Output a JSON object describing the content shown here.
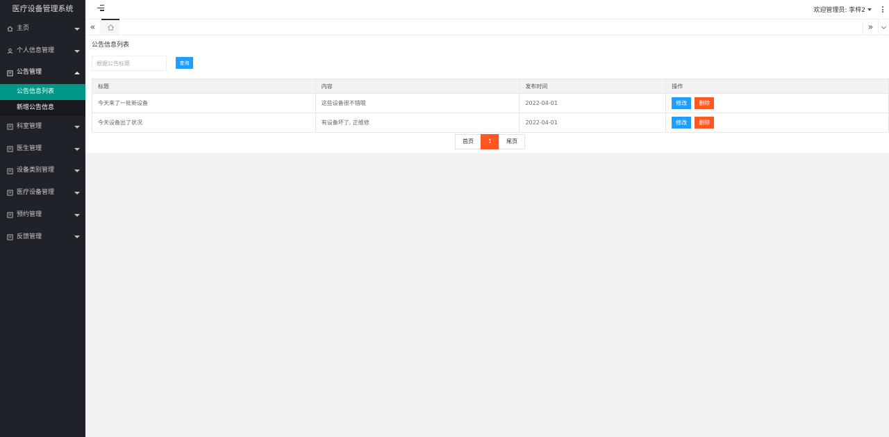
{
  "app": {
    "title": "医疗设备管理系统"
  },
  "sidebar": {
    "items": [
      {
        "label": "主页",
        "icon": "home-icon",
        "open": false
      },
      {
        "label": "个人信息管理",
        "icon": "user-icon",
        "open": false
      },
      {
        "label": "公告管理",
        "icon": "list-icon",
        "open": true,
        "children": [
          {
            "label": "公告信息列表",
            "active": true
          },
          {
            "label": "新增公告信息",
            "active": false
          }
        ]
      },
      {
        "label": "科室管理",
        "icon": "list-icon",
        "open": false
      },
      {
        "label": "医生管理",
        "icon": "list-icon",
        "open": false
      },
      {
        "label": "设备类别管理",
        "icon": "list-icon",
        "open": false
      },
      {
        "label": "医疗设备管理",
        "icon": "list-icon",
        "open": false
      },
      {
        "label": "预约管理",
        "icon": "list-icon",
        "open": false
      },
      {
        "label": "反馈管理",
        "icon": "list-icon",
        "open": false
      }
    ]
  },
  "header": {
    "welcome": "欢迎管理员: 李梓2"
  },
  "tabs": {
    "home_icon": "home-icon"
  },
  "content": {
    "title": "公告信息列表",
    "search": {
      "placeholder": "根据公告标题",
      "button": "查询"
    },
    "table": {
      "columns": [
        "标题",
        "内容",
        "发布时间",
        "操作"
      ],
      "rows": [
        {
          "title": "今天来了一批新设备",
          "content": "这些设备很不错哦",
          "time": "2022-04-01"
        },
        {
          "title": "今天设备出了状况",
          "content": "有设备坏了, 正维修",
          "time": "2022-04-01"
        }
      ],
      "edit_label": "修改",
      "delete_label": "删除"
    },
    "pager": {
      "first": "首页",
      "current": "1",
      "last": "尾页"
    }
  },
  "colors": {
    "sidebar_bg": "#20222a",
    "active_green": "#009688",
    "primary_blue": "#1e9fff",
    "danger_orange": "#ff5722"
  }
}
